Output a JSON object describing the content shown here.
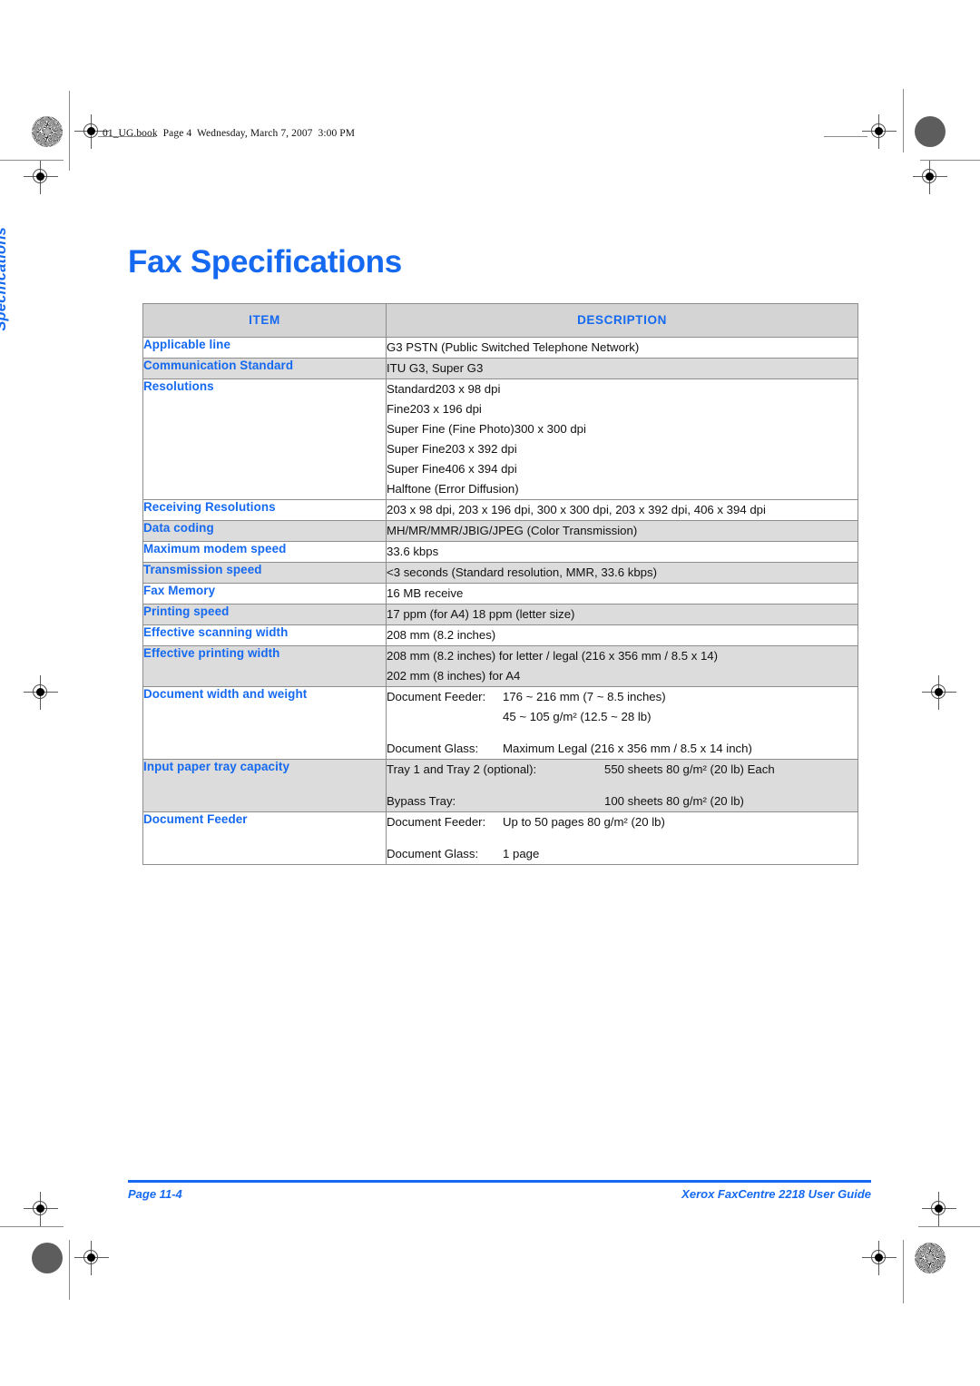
{
  "header": {
    "slug": "01_UG.book  Page 4  Wednesday, March 7, 2007  3:00 PM"
  },
  "side_tab": {
    "label": "Specifications"
  },
  "page": {
    "title": "Fax Specifications"
  },
  "colors": {
    "accent_blue": "#1569f0",
    "header_row_gray": "#d4d4d4",
    "shaded_row_gray": "#dcdcdc",
    "border_gray": "#8d8d8d"
  },
  "table": {
    "columns": [
      "ITEM",
      "DESCRIPTION"
    ],
    "rows": [
      {
        "item": "Applicable line",
        "shaded": false,
        "lines": [
          "G3 PSTN (Public Switched Telephone Network)"
        ]
      },
      {
        "item": "Communication Standard",
        "shaded": true,
        "lines": [
          "ITU G3, Super G3"
        ]
      },
      {
        "item": "Resolutions",
        "shaded": false,
        "lines": [
          "Standard203 x 98 dpi",
          "Fine203 x 196 dpi",
          "Super Fine (Fine Photo)300 x 300 dpi",
          "Super Fine203 x 392 dpi",
          "Super Fine406 x 394 dpi",
          "Halftone (Error Diffusion)"
        ]
      },
      {
        "item": "Receiving Resolutions",
        "shaded": false,
        "lines": [
          "203 x 98 dpi, 203 x 196 dpi, 300 x 300 dpi, 203 x 392 dpi, 406 x 394 dpi"
        ]
      },
      {
        "item": "Data coding",
        "shaded": true,
        "lines": [
          "MH/MR/MMR/JBIG/JPEG (Color Transmission)"
        ]
      },
      {
        "item": "Maximum modem speed",
        "shaded": false,
        "lines": [
          "33.6 kbps"
        ]
      },
      {
        "item": "Transmission speed",
        "shaded": true,
        "lines": [
          "<3 seconds (Standard resolution, MMR, 33.6 kbps)"
        ]
      },
      {
        "item": "Fax Memory",
        "shaded": false,
        "lines": [
          "16 MB receive"
        ]
      },
      {
        "item": "Printing speed",
        "shaded": true,
        "lines": [
          "17 ppm (for A4) 18 ppm (letter size)"
        ]
      },
      {
        "item": "Effective scanning width",
        "shaded": false,
        "lines": [
          "208 mm (8.2 inches)"
        ]
      },
      {
        "item": "Effective printing width",
        "shaded": true,
        "lines": [
          "208 mm (8.2 inches) for letter / legal (216 x 356 mm / 8.5 x 14)",
          "202 mm (8 inches) for A4"
        ]
      },
      {
        "item": "Document width and weight",
        "shaded": false,
        "label_width": "narrow",
        "pairs": [
          {
            "label": "Document Feeder:",
            "value": "176 ~ 216 mm (7 ~ 8.5 inches)"
          },
          {
            "label": "",
            "value": "45 ~ 105 g/m² (12.5 ~ 28 lb)"
          },
          {
            "label": "",
            "value": "",
            "spacer": true
          },
          {
            "label": "Document Glass:",
            "value": "Maximum Legal (216 x 356 mm / 8.5 x 14 inch)"
          }
        ]
      },
      {
        "item": "Input paper tray capacity",
        "shaded": true,
        "label_width": "wide",
        "pairs": [
          {
            "label": "Tray 1 and Tray 2 (optional):",
            "value": "550 sheets 80 g/m² (20 lb) Each"
          },
          {
            "label": "",
            "value": "",
            "spacer": true
          },
          {
            "label": "Bypass Tray:",
            "value": "100 sheets 80 g/m² (20 lb)"
          }
        ]
      },
      {
        "item": "Document Feeder",
        "shaded": false,
        "label_width": "narrow",
        "pairs": [
          {
            "label": "Document Feeder:",
            "value": "Up to 50 pages 80 g/m² (20 lb)"
          },
          {
            "label": "",
            "value": "",
            "spacer": true
          },
          {
            "label": "Document Glass:",
            "value": "1 page"
          }
        ]
      }
    ]
  },
  "footer": {
    "page_number": "Page 11-4",
    "guide_title": "Xerox FaxCentre 2218 User Guide"
  }
}
